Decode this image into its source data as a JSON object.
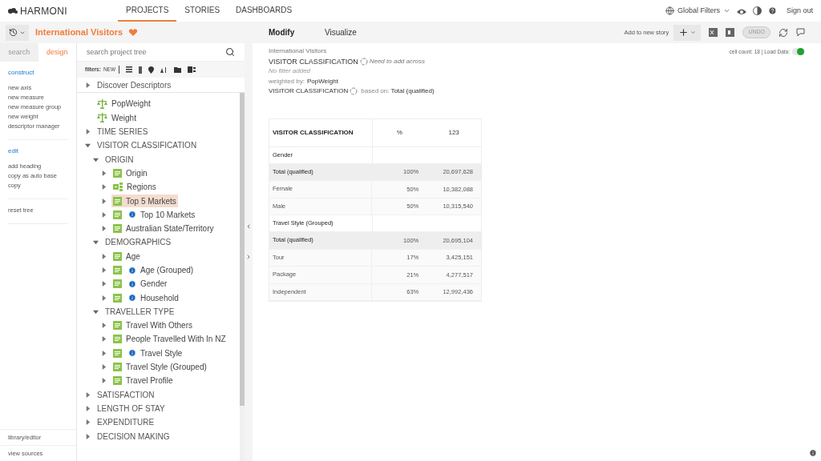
{
  "header": {
    "logo": "HARMONI",
    "nav": [
      {
        "label": "PROJECTS",
        "selected": true
      },
      {
        "label": "STORIES",
        "selected": false
      },
      {
        "label": "DASHBOARDS",
        "selected": false
      }
    ],
    "global_filters": "Global Filters",
    "sign_out": "Sign out"
  },
  "project": {
    "title": "International Visitors"
  },
  "sidebar": {
    "tabs": [
      {
        "label": "search",
        "selected": false
      },
      {
        "label": "design",
        "selected": true
      }
    ],
    "sections": [
      {
        "heading": "construct",
        "items": [
          "new axis",
          "new measure",
          "new measure group",
          "new weight",
          "descriptor manager"
        ]
      },
      {
        "heading": "edit",
        "items": [
          "add heading",
          "copy as auto base",
          "copy"
        ]
      },
      {
        "items": [
          "reset tree"
        ]
      }
    ],
    "footer": [
      "library/editor",
      "view sources"
    ]
  },
  "search": {
    "placeholder": "search project tree"
  },
  "filters": {
    "label": "filters:",
    "new": "NEW"
  },
  "tree": [
    {
      "kind": "folder",
      "label": "Discover Descriptors",
      "expanded": false,
      "selected": false
    },
    {
      "kind": "weight",
      "label": "PopWeight",
      "selected": false
    },
    {
      "kind": "weight",
      "label": "Weight",
      "selected": false
    },
    {
      "kind": "folder",
      "label": "TIME SERIES",
      "expanded": false,
      "selected": false
    },
    {
      "kind": "folder",
      "label": "VISITOR CLASSIFICATION",
      "expanded": true,
      "selected": false,
      "children": [
        {
          "kind": "folder",
          "label": "ORIGIN",
          "expanded": true,
          "selected": false,
          "children": [
            {
              "kind": "variable",
              "label": "Origin",
              "expanded": false,
              "selected": false,
              "info": false
            },
            {
              "kind": "group",
              "label": "Regions",
              "expanded": false,
              "selected": false,
              "info": false
            },
            {
              "kind": "variable",
              "label": "Top 5 Markets",
              "expanded": false,
              "selected": true,
              "info": false
            },
            {
              "kind": "variable",
              "label": "Top 10 Markets",
              "expanded": false,
              "selected": false,
              "info": true
            },
            {
              "kind": "variable",
              "label": "Australian State/Territory",
              "expanded": false,
              "selected": false,
              "info": false
            }
          ]
        },
        {
          "kind": "folder",
          "label": "DEMOGRAPHICS",
          "expanded": true,
          "selected": false,
          "children": [
            {
              "kind": "variable",
              "label": "Age",
              "expanded": false,
              "selected": false,
              "info": false
            },
            {
              "kind": "variable",
              "label": "Age (Grouped)",
              "expanded": false,
              "selected": false,
              "info": true
            },
            {
              "kind": "variable",
              "label": "Gender",
              "expanded": false,
              "selected": false,
              "info": true
            },
            {
              "kind": "variable",
              "label": "Household",
              "expanded": false,
              "selected": false,
              "info": true
            }
          ]
        },
        {
          "kind": "folder",
          "label": "TRAVELLER TYPE",
          "expanded": true,
          "selected": false,
          "children": [
            {
              "kind": "variable",
              "label": "Travel With Others",
              "expanded": false,
              "selected": false,
              "info": false
            },
            {
              "kind": "variable",
              "label": "People Travelled With In NZ",
              "expanded": false,
              "selected": false,
              "info": false
            },
            {
              "kind": "variable",
              "label": "Travel Style",
              "expanded": false,
              "selected": false,
              "info": true
            },
            {
              "kind": "variable",
              "label": "Travel Style (Grouped)",
              "expanded": false,
              "selected": false,
              "info": false
            },
            {
              "kind": "variable",
              "label": "Travel Profile",
              "expanded": false,
              "selected": false,
              "info": false
            }
          ]
        }
      ]
    },
    {
      "kind": "folder",
      "label": "SATISFACTION",
      "expanded": false,
      "selected": false
    },
    {
      "kind": "folder",
      "label": "LENGTH OF STAY",
      "expanded": false,
      "selected": false
    },
    {
      "kind": "folder",
      "label": "EXPENDITURE",
      "expanded": false,
      "selected": false
    },
    {
      "kind": "folder",
      "label": "DECISION MAKING",
      "expanded": false,
      "selected": false
    }
  ],
  "main": {
    "tabs": [
      {
        "label": "Modify",
        "selected": true
      },
      {
        "label": "Visualize",
        "selected": false
      }
    ],
    "add_to_story": "Add to new story",
    "undo": "UNDO",
    "summary": {
      "project": "International Visitors",
      "down": "VISITOR CLASSIFICATION",
      "across_note": "Need to add across",
      "filter_note": "No filter added",
      "weighted_label": "weighted by:",
      "weighted_value": "PopWeight",
      "base_var": "VISITOR CLASSIFICATION",
      "based_label": "based on:",
      "based_value": "Total (qualified)"
    },
    "cell_count": "cell count: 18 | Load Data:",
    "load_data": {
      "on": true
    },
    "table": {
      "columns": [
        "VISITOR CLASSIFICATION",
        "%",
        "123"
      ],
      "rows": [
        {
          "kind": "section",
          "cells": [
            "Gender"
          ]
        },
        {
          "kind": "total",
          "cells": [
            "Total (qualified)",
            "100%",
            "20,697,628"
          ]
        },
        {
          "kind": "row",
          "cells": [
            "Female",
            "50%",
            "10,382,088"
          ]
        },
        {
          "kind": "row",
          "cells": [
            "Male",
            "50%",
            "10,315,540"
          ]
        },
        {
          "kind": "section",
          "cells": [
            "Travel Style (Grouped)"
          ]
        },
        {
          "kind": "total",
          "cells": [
            "Total (qualified)",
            "100%",
            "20,695,104"
          ]
        },
        {
          "kind": "row",
          "cells": [
            "Tour",
            "17%",
            "3,425,151"
          ]
        },
        {
          "kind": "row",
          "cells": [
            "Package",
            "21%",
            "4,277,517"
          ]
        },
        {
          "kind": "row",
          "cells": [
            "Independent",
            "63%",
            "12,992,436"
          ]
        }
      ]
    }
  }
}
